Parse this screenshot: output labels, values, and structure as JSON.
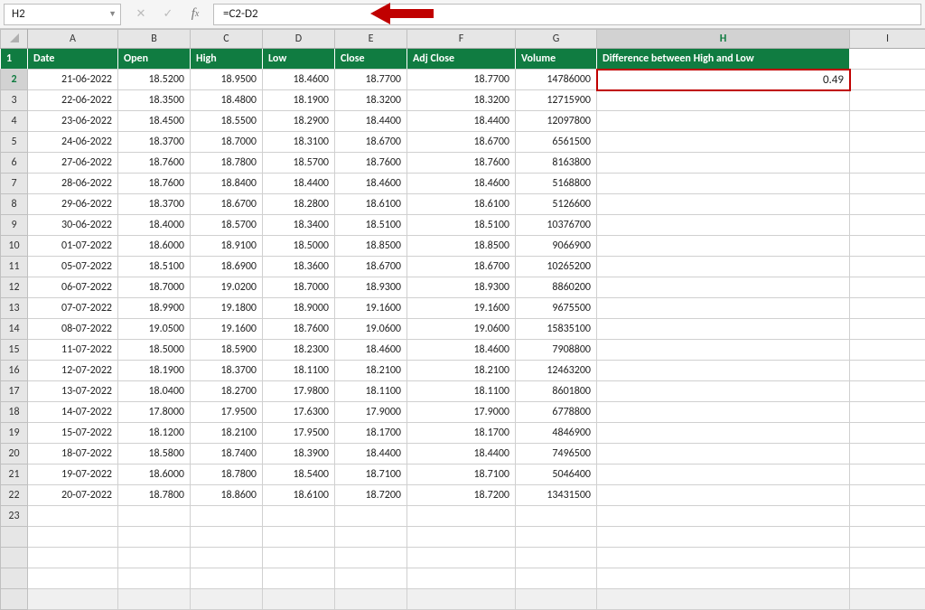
{
  "selectedCell": "H2",
  "formula": "=C2-D2",
  "columns": [
    "A",
    "B",
    "C",
    "D",
    "E",
    "F",
    "G",
    "H",
    "I"
  ],
  "headers": {
    "A": "Date",
    "B": "Open",
    "C": "High",
    "D": "Low",
    "E": "Close",
    "F": "Adj Close",
    "G": "Volume",
    "H": "Difference between High and Low"
  },
  "h2_value": "0.49",
  "rows": [
    {
      "n": 1
    },
    {
      "n": 2,
      "date": "21-06-2022",
      "open": "18.5200",
      "high": "18.9500",
      "low": "18.4600",
      "close": "18.7700",
      "adj": "18.7700",
      "vol": "14786000"
    },
    {
      "n": 3,
      "date": "22-06-2022",
      "open": "18.3500",
      "high": "18.4800",
      "low": "18.1900",
      "close": "18.3200",
      "adj": "18.3200",
      "vol": "12715900"
    },
    {
      "n": 4,
      "date": "23-06-2022",
      "open": "18.4500",
      "high": "18.5500",
      "low": "18.2900",
      "close": "18.4400",
      "adj": "18.4400",
      "vol": "12097800"
    },
    {
      "n": 5,
      "date": "24-06-2022",
      "open": "18.3700",
      "high": "18.7000",
      "low": "18.3100",
      "close": "18.6700",
      "adj": "18.6700",
      "vol": "6561500"
    },
    {
      "n": 6,
      "date": "27-06-2022",
      "open": "18.7600",
      "high": "18.7800",
      "low": "18.5700",
      "close": "18.7600",
      "adj": "18.7600",
      "vol": "8163800"
    },
    {
      "n": 7,
      "date": "28-06-2022",
      "open": "18.7600",
      "high": "18.8400",
      "low": "18.4400",
      "close": "18.4600",
      "adj": "18.4600",
      "vol": "5168800"
    },
    {
      "n": 8,
      "date": "29-06-2022",
      "open": "18.3700",
      "high": "18.6700",
      "low": "18.2800",
      "close": "18.6100",
      "adj": "18.6100",
      "vol": "5126600"
    },
    {
      "n": 9,
      "date": "30-06-2022",
      "open": "18.4000",
      "high": "18.5700",
      "low": "18.3400",
      "close": "18.5100",
      "adj": "18.5100",
      "vol": "10376700"
    },
    {
      "n": 10,
      "date": "01-07-2022",
      "open": "18.6000",
      "high": "18.9100",
      "low": "18.5000",
      "close": "18.8500",
      "adj": "18.8500",
      "vol": "9066900"
    },
    {
      "n": 11,
      "date": "05-07-2022",
      "open": "18.5100",
      "high": "18.6900",
      "low": "18.3600",
      "close": "18.6700",
      "adj": "18.6700",
      "vol": "10265200"
    },
    {
      "n": 12,
      "date": "06-07-2022",
      "open": "18.7000",
      "high": "19.0200",
      "low": "18.7000",
      "close": "18.9300",
      "adj": "18.9300",
      "vol": "8860200"
    },
    {
      "n": 13,
      "date": "07-07-2022",
      "open": "18.9900",
      "high": "19.1800",
      "low": "18.9000",
      "close": "19.1600",
      "adj": "19.1600",
      "vol": "9675500"
    },
    {
      "n": 14,
      "date": "08-07-2022",
      "open": "19.0500",
      "high": "19.1600",
      "low": "18.7600",
      "close": "19.0600",
      "adj": "19.0600",
      "vol": "15835100"
    },
    {
      "n": 15,
      "date": "11-07-2022",
      "open": "18.5000",
      "high": "18.5900",
      "low": "18.2300",
      "close": "18.4600",
      "adj": "18.4600",
      "vol": "7908800"
    },
    {
      "n": 16,
      "date": "12-07-2022",
      "open": "18.1900",
      "high": "18.3700",
      "low": "18.1100",
      "close": "18.2100",
      "adj": "18.2100",
      "vol": "12463200"
    },
    {
      "n": 17,
      "date": "13-07-2022",
      "open": "18.0400",
      "high": "18.2700",
      "low": "17.9800",
      "close": "18.1100",
      "adj": "18.1100",
      "vol": "8601800"
    },
    {
      "n": 18,
      "date": "14-07-2022",
      "open": "17.8000",
      "high": "17.9500",
      "low": "17.6300",
      "close": "17.9000",
      "adj": "17.9000",
      "vol": "6778800"
    },
    {
      "n": 19,
      "date": "15-07-2022",
      "open": "18.1200",
      "high": "18.2100",
      "low": "17.9500",
      "close": "18.1700",
      "adj": "18.1700",
      "vol": "4846900"
    },
    {
      "n": 20,
      "date": "18-07-2022",
      "open": "18.5800",
      "high": "18.7400",
      "low": "18.3900",
      "close": "18.4400",
      "adj": "18.4400",
      "vol": "7496500"
    },
    {
      "n": 21,
      "date": "19-07-2022",
      "open": "18.6000",
      "high": "18.7800",
      "low": "18.5400",
      "close": "18.7100",
      "adj": "18.7100",
      "vol": "5046400"
    },
    {
      "n": 22,
      "date": "20-07-2022",
      "open": "18.7800",
      "high": "18.8600",
      "low": "18.6100",
      "close": "18.7200",
      "adj": "18.7200",
      "vol": "13431500"
    },
    {
      "n": 23
    }
  ]
}
